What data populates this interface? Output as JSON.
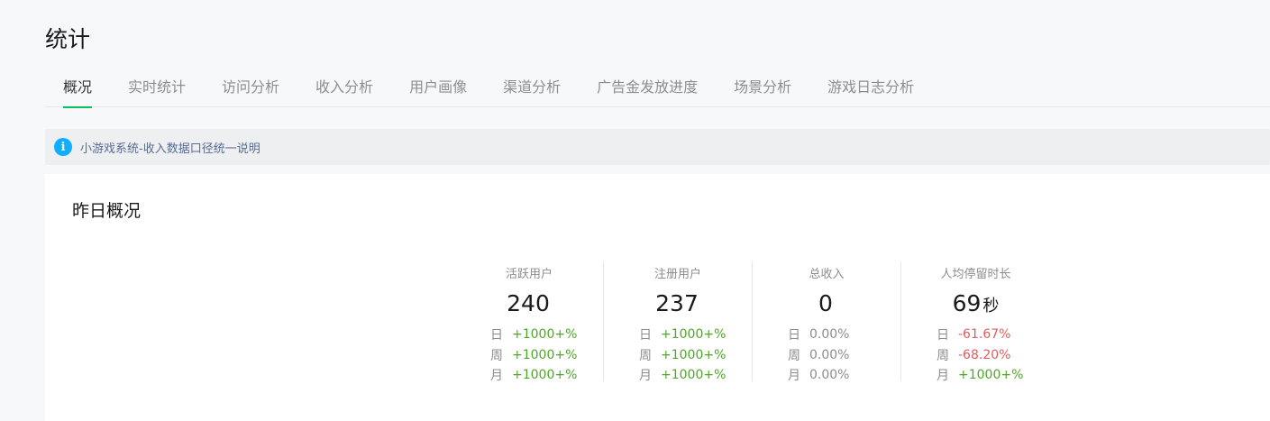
{
  "page_title": "统计",
  "tabs": [
    {
      "label": "概况",
      "active": true
    },
    {
      "label": "实时统计",
      "active": false
    },
    {
      "label": "访问分析",
      "active": false
    },
    {
      "label": "收入分析",
      "active": false
    },
    {
      "label": "用户画像",
      "active": false
    },
    {
      "label": "渠道分析",
      "active": false
    },
    {
      "label": "广告金发放进度",
      "active": false
    },
    {
      "label": "场景分析",
      "active": false
    },
    {
      "label": "游戏日志分析",
      "active": false
    }
  ],
  "notice": {
    "icon": "info-icon",
    "icon_glyph": "i",
    "text": "小游戏系统-收入数据口径统一说明"
  },
  "overview": {
    "title": "昨日概况",
    "metrics": [
      {
        "label": "活跃用户",
        "value": "240",
        "unit": "",
        "comparisons": [
          {
            "key": "日",
            "value": "+1000+%",
            "trend": "up"
          },
          {
            "key": "周",
            "value": "+1000+%",
            "trend": "up"
          },
          {
            "key": "月",
            "value": "+1000+%",
            "trend": "up"
          }
        ]
      },
      {
        "label": "注册用户",
        "value": "237",
        "unit": "",
        "comparisons": [
          {
            "key": "日",
            "value": "+1000+%",
            "trend": "up"
          },
          {
            "key": "周",
            "value": "+1000+%",
            "trend": "up"
          },
          {
            "key": "月",
            "value": "+1000+%",
            "trend": "up"
          }
        ]
      },
      {
        "label": "总收入",
        "value": "0",
        "unit": "",
        "comparisons": [
          {
            "key": "日",
            "value": "0.00%",
            "trend": "flat"
          },
          {
            "key": "周",
            "value": "0.00%",
            "trend": "flat"
          },
          {
            "key": "月",
            "value": "0.00%",
            "trend": "flat"
          }
        ]
      },
      {
        "label": "人均停留时长",
        "value": "69",
        "unit": "秒",
        "comparisons": [
          {
            "key": "日",
            "value": "-61.67%",
            "trend": "down"
          },
          {
            "key": "周",
            "value": "-68.20%",
            "trend": "down"
          },
          {
            "key": "月",
            "value": "+1000+%",
            "trend": "up"
          }
        ]
      }
    ]
  },
  "colors": {
    "accent": "#07c160",
    "info": "#10aeff",
    "up": "#4fa728",
    "down": "#e25c5c",
    "link": "#576b95"
  }
}
